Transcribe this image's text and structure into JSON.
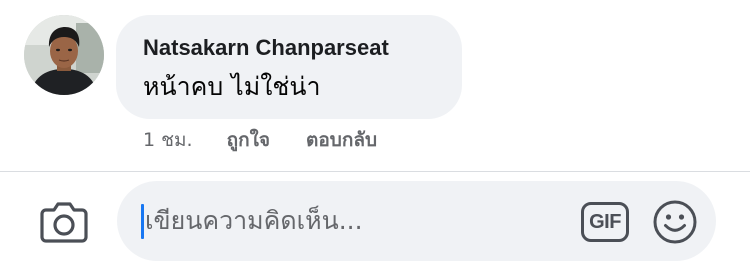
{
  "comment": {
    "author": "Natsakarn Chanparseat",
    "text": "หน้าคบ ไม่ใช่น่า",
    "avatar_icon": "profile-photo"
  },
  "actions": {
    "time": "1 ชม.",
    "like_label": "ถูกใจ",
    "reply_label": "ตอบกลับ"
  },
  "composer": {
    "camera_icon": "camera-icon",
    "placeholder": "เขียนความคิดเห็น...",
    "gif_label": "GIF",
    "emoji_icon": "smiley-icon"
  },
  "colors": {
    "bubble_bg": "#f0f2f5",
    "text_primary": "#050505",
    "text_secondary": "#65676b",
    "caret": "#1877f2",
    "icon": "#4b4f56"
  }
}
